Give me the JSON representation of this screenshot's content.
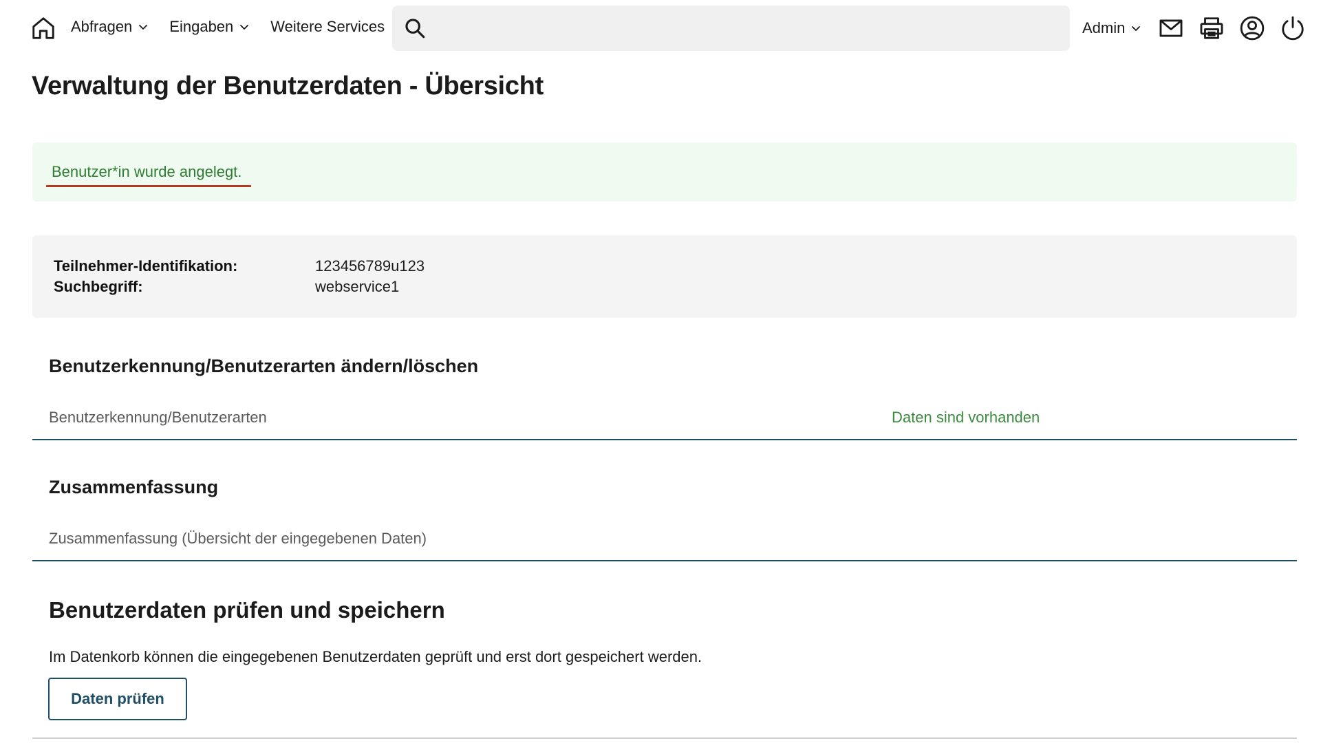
{
  "nav": {
    "items": [
      {
        "label": "Abfragen",
        "has_dropdown": true
      },
      {
        "label": "Eingaben",
        "has_dropdown": true
      },
      {
        "label": "Weitere Services",
        "has_dropdown": false
      }
    ],
    "search_placeholder": "",
    "admin_label": "Admin",
    "icons": [
      "home-icon",
      "search-icon",
      "chevron-down-icon",
      "mail-icon",
      "printer-icon",
      "user-account-icon",
      "power-icon"
    ]
  },
  "page": {
    "title": "Verwaltung der Benutzerdaten - Übersicht"
  },
  "alert": {
    "message": "Benutzer*in wurde angelegt.",
    "text_color": "#2e7d32",
    "background": "#effaf0",
    "underline_color": "#b33a1f"
  },
  "info": {
    "rows": [
      {
        "label": "Teilnehmer-Identifikation:",
        "value": "123456789u123"
      },
      {
        "label": "Suchbegriff:",
        "value": "webservice1"
      }
    ]
  },
  "sections": {
    "user_types": {
      "title": "Benutzerkennung/Benutzerarten ändern/löschen",
      "row_label": "Benutzerkennung/Benutzerarten",
      "row_status": "Daten sind vorhanden"
    },
    "summary": {
      "title": "Zusammenfassung",
      "row_label": "Zusammenfassung (Übersicht der eingegebenen Daten)"
    },
    "check": {
      "title": "Benutzerdaten prüfen und speichern",
      "description": "Im Datenkorb können die eingegebenen Benutzerdaten geprüft und erst dort gespeichert werden.",
      "button_label": "Daten prüfen"
    }
  },
  "colors": {
    "accent": "#1f4e66",
    "status_green": "#3b8a3e"
  }
}
